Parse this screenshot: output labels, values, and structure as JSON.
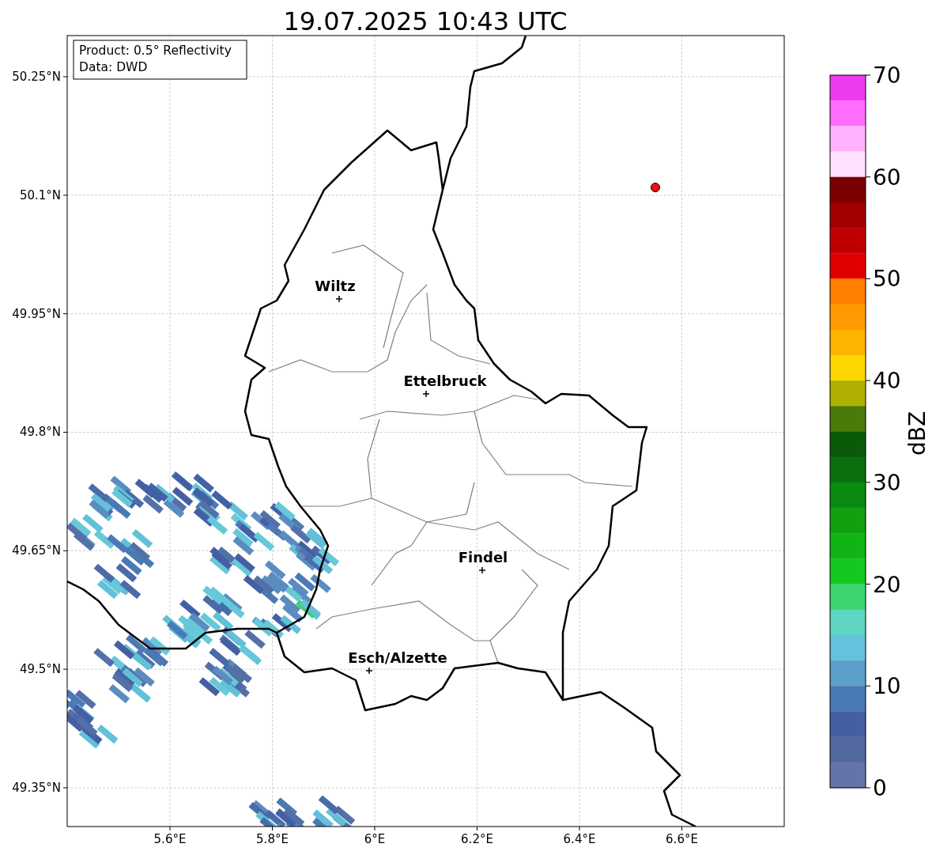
{
  "title": "19.07.2025 10:43 UTC",
  "info_box": {
    "lines": [
      "Product: 0.5° Reflectivity",
      "Data: DWD"
    ]
  },
  "y_axis": {
    "ticks": [
      "50.25°N",
      "50.1°N",
      "49.95°N",
      "49.8°N",
      "49.65°N",
      "49.5°N",
      "49.35°N"
    ]
  },
  "x_axis": {
    "ticks": [
      "5.6°E",
      "5.8°E",
      "6°E",
      "6.2°E",
      "6.4°E",
      "6.6°E"
    ]
  },
  "cities": [
    {
      "name": "Wiltz"
    },
    {
      "name": "Ettelbruck"
    },
    {
      "name": "Findel"
    },
    {
      "name": "Esch/Alzette"
    }
  ],
  "colorbar": {
    "label": "dBZ",
    "ticks": [
      "70",
      "60",
      "50",
      "40",
      "30",
      "20",
      "10",
      "0"
    ],
    "bins": [
      {
        "color": "#ee3aee"
      },
      {
        "color": "#ff6eff"
      },
      {
        "color": "#ffb3ff"
      },
      {
        "color": "#ffe0ff"
      },
      {
        "color": "#7a0000"
      },
      {
        "color": "#a00000"
      },
      {
        "color": "#c00000"
      },
      {
        "color": "#e00000"
      },
      {
        "color": "#ff7f00"
      },
      {
        "color": "#ff9a00"
      },
      {
        "color": "#ffb400"
      },
      {
        "color": "#ffd700"
      },
      {
        "color": "#b0b000"
      },
      {
        "color": "#4a7a0a"
      },
      {
        "color": "#0a5a0a"
      },
      {
        "color": "#0a700f"
      },
      {
        "color": "#0a8a10"
      },
      {
        "color": "#10a010"
      },
      {
        "color": "#10b515"
      },
      {
        "color": "#15c820"
      },
      {
        "color": "#3ed56e"
      },
      {
        "color": "#5fd6c4"
      },
      {
        "color": "#66c2dc"
      },
      {
        "color": "#5aa0c8"
      },
      {
        "color": "#4a7ab5"
      },
      {
        "color": "#4460a4"
      },
      {
        "color": "#5468a0"
      },
      {
        "color": "#6474a8"
      }
    ]
  }
}
